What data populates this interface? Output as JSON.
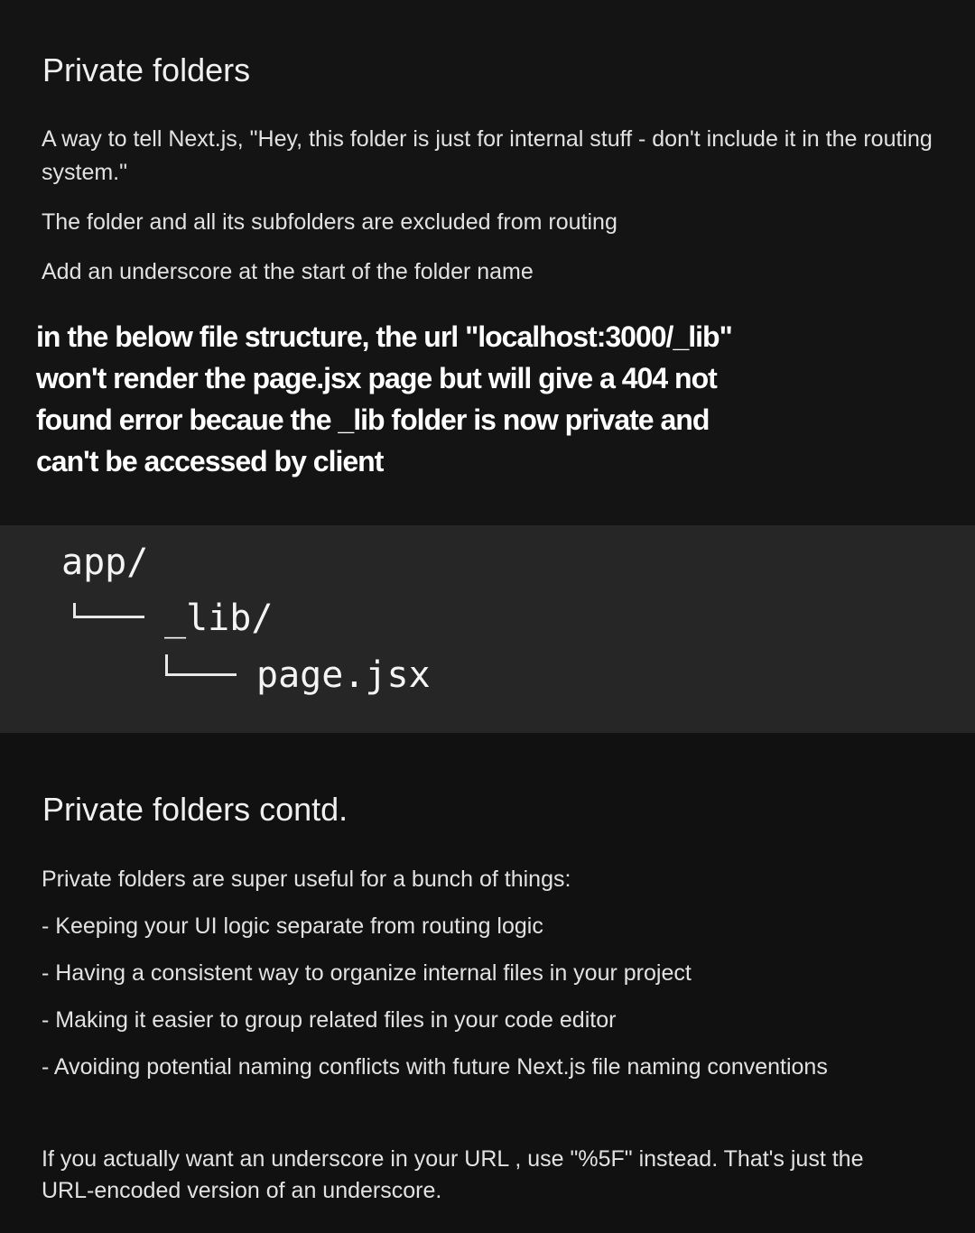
{
  "slide1": {
    "title": "Private folders",
    "paragraphs": [
      "A way to tell Next.js, \"Hey, this folder is just for internal stuff - don't include it in the routing system.\"",
      "The folder and all its subfolders are excluded from routing",
      "Add an underscore at the start of the folder name"
    ]
  },
  "note": {
    "text": "in the below file structure, the url \"localhost:3000/_lib\" won't render the page.jsx page but will give a 404 not found error becaue the _lib folder is now private and can't be accessed by client"
  },
  "file_tree": {
    "root": "app/",
    "child": "_lib/",
    "grandchild": "page.jsx"
  },
  "slide2": {
    "title": "Private folders contd.",
    "intro": "Private folders are super useful for a bunch of things:",
    "items": [
      "- Keeping your UI logic separate from routing logic",
      "- Having a consistent way to organize internal files in your project",
      "- Making it easier to group related files in your code editor",
      "- Avoiding potential naming conflicts with future Next.js file naming conventions"
    ],
    "footer": "If you actually want an underscore in your URL , use \"%5F\" instead. That's just the URL-encoded version of an underscore."
  }
}
